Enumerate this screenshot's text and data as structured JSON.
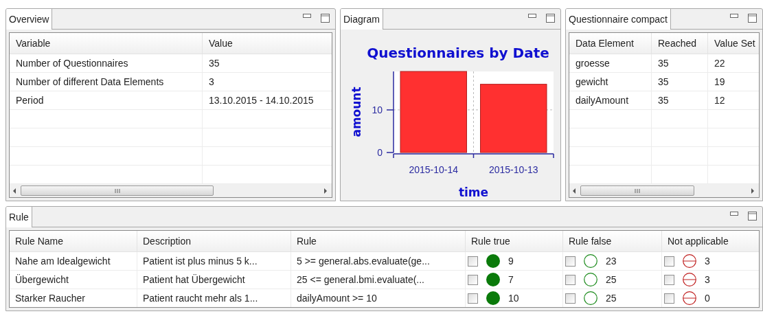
{
  "overview": {
    "tab": "Overview",
    "columns": [
      "Variable",
      "Value"
    ],
    "rows": [
      [
        "Number of Questionnaires",
        "35"
      ],
      [
        "Number of different Data Elements",
        "3"
      ],
      [
        "Period",
        "13.10.2015 - 14.10.2015"
      ]
    ]
  },
  "diagram": {
    "tab": "Diagram",
    "chart_data": {
      "type": "bar",
      "title": "Questionnaires by Date",
      "xlabel": "time",
      "ylabel": "amount",
      "categories": [
        "2015-10-14",
        "2015-10-13"
      ],
      "values": [
        19,
        16
      ],
      "ylim": [
        0,
        19
      ],
      "yticks": [
        0,
        10
      ]
    }
  },
  "questionnaire_compact": {
    "tab": "Questionnaire compact",
    "columns": [
      "Data Element",
      "Reached",
      "Value Set"
    ],
    "rows": [
      [
        "groesse",
        "35",
        "22"
      ],
      [
        "gewicht",
        "35",
        "19"
      ],
      [
        "dailyAmount",
        "35",
        "12"
      ]
    ]
  },
  "rule": {
    "tab": "Rule",
    "columns": [
      "Rule Name",
      "Description",
      "Rule",
      "Rule true",
      "Rule false",
      "Not applicable"
    ],
    "rows": [
      {
        "name": "Nahe am Idealgewicht",
        "description": "Patient ist plus minus 5 k...",
        "rule": "5 >= general.abs.evaluate(ge...",
        "true": {
          "checked": false,
          "count": "9"
        },
        "false": {
          "checked": false,
          "count": "23"
        },
        "na": {
          "checked": false,
          "count": "3"
        }
      },
      {
        "name": "Übergewicht",
        "description": "Patient hat Übergewicht",
        "rule": "25 <= general.bmi.evaluate(...",
        "true": {
          "checked": false,
          "count": "7"
        },
        "false": {
          "checked": false,
          "count": "25"
        },
        "na": {
          "checked": false,
          "count": "3"
        }
      },
      {
        "name": "Starker Raucher",
        "description": "Patient raucht mehr als 1...",
        "rule": "dailyAmount >= 10",
        "true": {
          "checked": false,
          "count": "10"
        },
        "false": {
          "checked": false,
          "count": "25"
        },
        "na": {
          "checked": false,
          "count": "0"
        }
      }
    ]
  }
}
